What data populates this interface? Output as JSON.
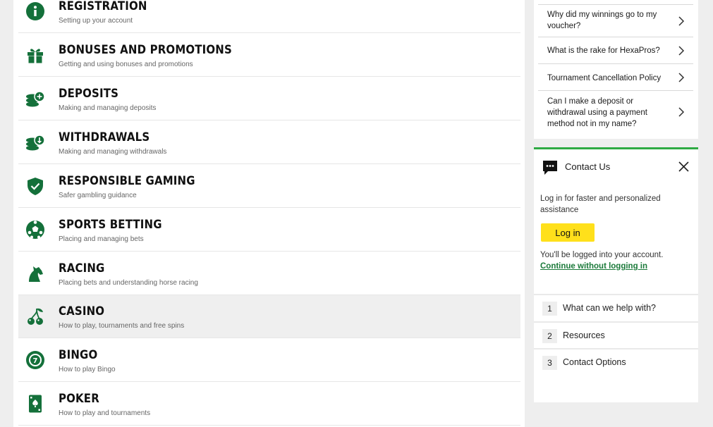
{
  "categories": [
    {
      "title": "REGISTRATION",
      "desc": "Setting up your account",
      "icon": "info-icon"
    },
    {
      "title": "BONUSES AND PROMOTIONS",
      "desc": "Getting and using bonuses and promotions",
      "icon": "gift-icon"
    },
    {
      "title": "DEPOSITS",
      "desc": "Making and managing deposits",
      "icon": "coins-plus-icon"
    },
    {
      "title": "WITHDRAWALS",
      "desc": "Making and managing withdrawals",
      "icon": "coins-down-icon"
    },
    {
      "title": "RESPONSIBLE GAMING",
      "desc": "Safer gambling guidance",
      "icon": "shield-check-icon"
    },
    {
      "title": "SPORTS BETTING",
      "desc": "Placing and managing bets",
      "icon": "soccer-ball-icon"
    },
    {
      "title": "RACING",
      "desc": "Placing bets and understanding horse racing",
      "icon": "horse-icon"
    },
    {
      "title": "CASINO",
      "desc": "How to play, tournaments and free spins",
      "icon": "cherries-icon"
    },
    {
      "title": "BINGO",
      "desc": "How to play Bingo",
      "icon": "bingo-ball-icon"
    },
    {
      "title": "POKER",
      "desc": "How to play and tournaments",
      "icon": "playing-card-icon"
    }
  ],
  "faq": [
    {
      "text": "Why did my winnings go to my voucher?"
    },
    {
      "text": "What is the rake for HexaPros?"
    },
    {
      "text": "Tournament Cancellation Policy"
    },
    {
      "text": "Can I make a deposit or withdrawal using a payment method not in my name?"
    }
  ],
  "contact": {
    "title": "Contact Us",
    "message": "Log in for faster and personalized assistance",
    "login_label": "Log in",
    "logged_note": "You'll be logged into your account.",
    "continue_label": "Continue without logging in",
    "steps": [
      {
        "num": "1",
        "label": "What can we help with?"
      },
      {
        "num": "2",
        "label": "Resources"
      },
      {
        "num": "3",
        "label": "Contact Options"
      }
    ]
  },
  "colors": {
    "brand_green": "#14703a",
    "accent_green": "#2eaa43",
    "login_yellow": "#ffe01b"
  }
}
